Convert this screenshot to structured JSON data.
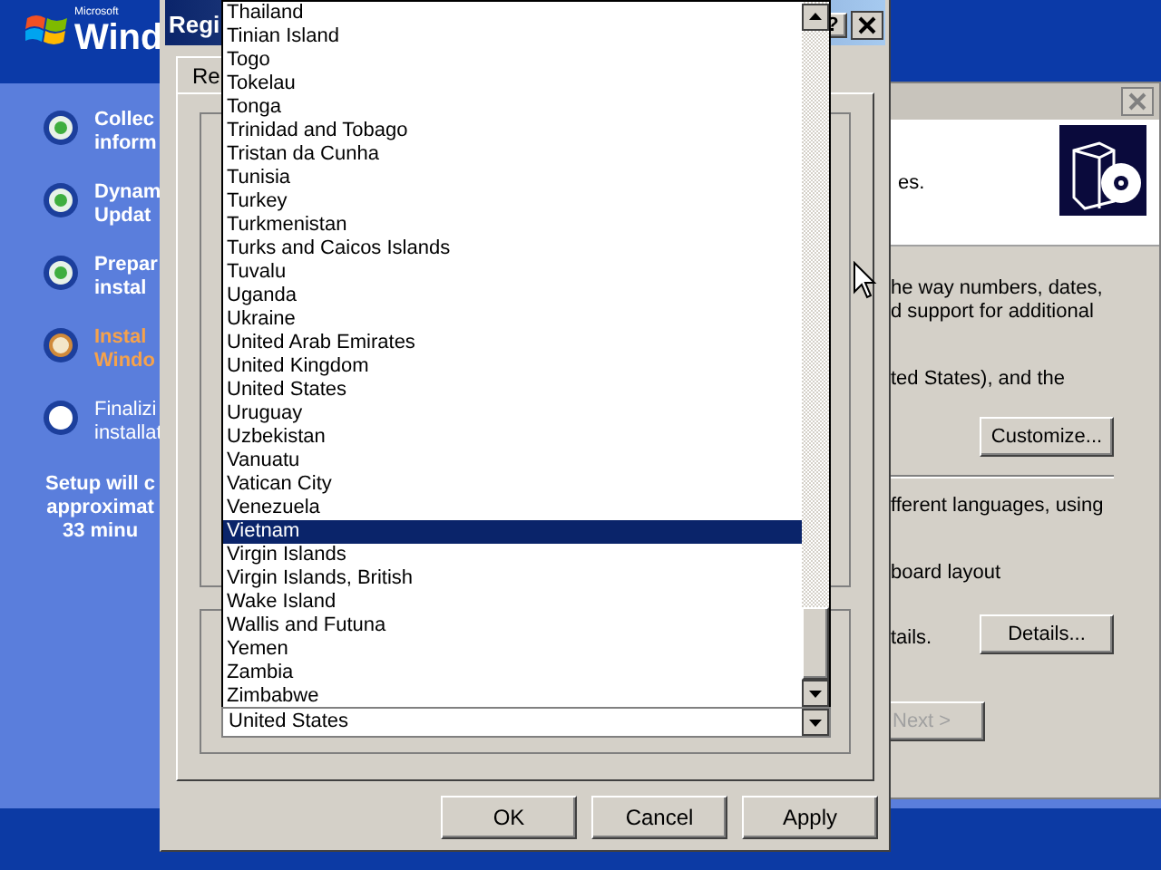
{
  "setup": {
    "logo_small": "Microsoft",
    "logo": "Wind",
    "steps": [
      {
        "lines": [
          "Collec",
          "inform"
        ],
        "completed": true,
        "current": false
      },
      {
        "lines": [
          "Dynam",
          "Updat"
        ],
        "completed": true,
        "current": false
      },
      {
        "lines": [
          "Prepar",
          "instal"
        ],
        "completed": true,
        "current": false
      },
      {
        "lines": [
          "Instal",
          "Windo"
        ],
        "completed": false,
        "current": true
      },
      {
        "lines": [
          "Finalizi",
          "installat"
        ],
        "completed": false,
        "current": false
      }
    ],
    "estimate": [
      "Setup will c",
      "approximat",
      "33 minu"
    ]
  },
  "wizard": {
    "header": "es.",
    "body": [
      {
        "kind": "text",
        "text": "he way numbers, dates,"
      },
      {
        "kind": "text",
        "text": "d support for additional"
      },
      {
        "kind": "text",
        "text": "ted States), and the"
      },
      {
        "kind": "button",
        "text": "Customize..."
      },
      {
        "kind": "separator"
      },
      {
        "kind": "text",
        "text": "fferent languages, using"
      },
      {
        "kind": "text",
        "text": "board layout"
      },
      {
        "kind": "text_button",
        "text": "tails.",
        "button": "Details..."
      },
      {
        "kind": "disabled_button",
        "text": "Next >"
      }
    ]
  },
  "dialog": {
    "title": "Regi",
    "help": "?",
    "tab": "Re",
    "dropdown": {
      "items": [
        {
          "label": "Thailand",
          "selected": false
        },
        {
          "label": "Tinian Island",
          "selected": false
        },
        {
          "label": "Togo",
          "selected": false
        },
        {
          "label": "Tokelau",
          "selected": false
        },
        {
          "label": "Tonga",
          "selected": false
        },
        {
          "label": "Trinidad and Tobago",
          "selected": false
        },
        {
          "label": "Tristan da Cunha",
          "selected": false
        },
        {
          "label": "Tunisia",
          "selected": false
        },
        {
          "label": "Turkey",
          "selected": false
        },
        {
          "label": "Turkmenistan",
          "selected": false
        },
        {
          "label": "Turks and Caicos Islands",
          "selected": false
        },
        {
          "label": "Tuvalu",
          "selected": false
        },
        {
          "label": "Uganda",
          "selected": false
        },
        {
          "label": "Ukraine",
          "selected": false
        },
        {
          "label": "United Arab Emirates",
          "selected": false
        },
        {
          "label": "United Kingdom",
          "selected": false
        },
        {
          "label": "United States",
          "selected": false
        },
        {
          "label": "Uruguay",
          "selected": false
        },
        {
          "label": "Uzbekistan",
          "selected": false
        },
        {
          "label": "Vanuatu",
          "selected": false
        },
        {
          "label": "Vatican City",
          "selected": false
        },
        {
          "label": "Venezuela",
          "selected": false
        },
        {
          "label": "Vietnam",
          "selected": true
        },
        {
          "label": "Virgin Islands",
          "selected": false
        },
        {
          "label": "Virgin Islands, British",
          "selected": false
        },
        {
          "label": "Wake Island",
          "selected": false
        },
        {
          "label": "Wallis and Futuna",
          "selected": false
        },
        {
          "label": "Yemen",
          "selected": false
        },
        {
          "label": "Zambia",
          "selected": false
        },
        {
          "label": "Zimbabwe",
          "selected": false
        }
      ]
    },
    "combo_value": "United States",
    "buttons": [
      "OK",
      "Cancel",
      "Apply"
    ]
  }
}
